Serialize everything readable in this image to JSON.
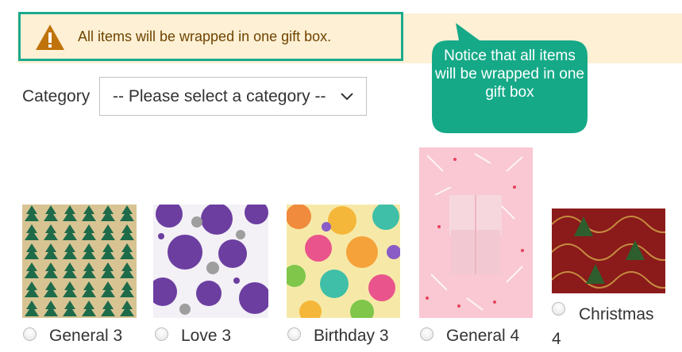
{
  "notice": {
    "message": "All items will be wrapped in one gift box.",
    "icon": "warning-icon",
    "background": "#fdf0d5",
    "text_color": "#6f4400",
    "highlight_color": "#1aaa8c"
  },
  "callout": {
    "text": "Notice that all items will be wrapped in one gift box",
    "background": "#15a987"
  },
  "category": {
    "label": "Category",
    "selected": "-- Please select a category --"
  },
  "wraps": [
    {
      "label": "General 3",
      "selected": false,
      "pattern": "green-trees-on-kraft"
    },
    {
      "label": "Love 3",
      "selected": false,
      "pattern": "purple-love-you-circles"
    },
    {
      "label": "Birthday 3",
      "selected": false,
      "pattern": "colorful-happy-birthday-flowers"
    },
    {
      "label": "General 4",
      "selected": false,
      "pattern": "pink-box-with-confetti"
    },
    {
      "label": "Christmas 4",
      "selected": false,
      "pattern": "red-gold-christmas-trees"
    }
  ]
}
